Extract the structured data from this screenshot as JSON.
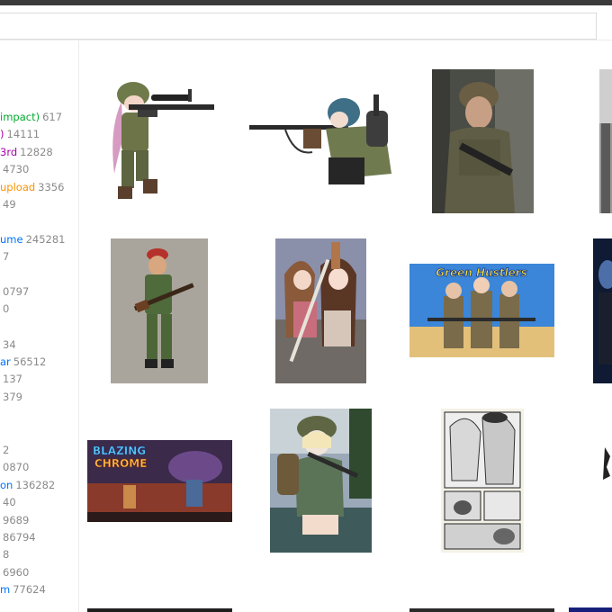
{
  "sidebar": {
    "tags": [
      {
        "name": "impact)",
        "count": "617",
        "color": "#00ab2c"
      },
      {
        "name": ")",
        "count": "14111",
        "color": "#a800aa"
      },
      {
        "name": "3rd",
        "count": "12828",
        "color": "#a800aa"
      },
      {
        "name": "",
        "count": "4730",
        "color": "#8a8a8a"
      },
      {
        "name": "upload",
        "count": "3356",
        "color": "#fd9200"
      },
      {
        "name": "",
        "count": "49",
        "color": "#8a8a8a"
      },
      {
        "name": "ume",
        "count": "245281",
        "color": "#0073ff"
      },
      {
        "name": "",
        "count": "7",
        "color": "#8a8a8a"
      },
      {
        "name": "",
        "count": "0797",
        "color": "#8a8a8a"
      },
      {
        "name": "",
        "count": "0",
        "color": "#8a8a8a"
      },
      {
        "name": "",
        "count": "34",
        "color": "#8a8a8a"
      },
      {
        "name": "ar",
        "count": "56512",
        "color": "#0073ff"
      },
      {
        "name": "",
        "count": "137",
        "color": "#8a8a8a"
      },
      {
        "name": "",
        "count": "379",
        "color": "#8a8a8a"
      },
      {
        "name": "",
        "count": "2",
        "color": "#8a8a8a"
      },
      {
        "name": "",
        "count": "0870",
        "color": "#8a8a8a"
      },
      {
        "name": "on",
        "count": "136282",
        "color": "#0073ff"
      },
      {
        "name": "",
        "count": "40",
        "color": "#8a8a8a"
      },
      {
        "name": "",
        "count": "9689",
        "color": "#8a8a8a"
      },
      {
        "name": "",
        "count": "86794",
        "color": "#8a8a8a"
      },
      {
        "name": "",
        "count": "8",
        "color": "#8a8a8a"
      },
      {
        "name": "",
        "count": "6960",
        "color": "#8a8a8a"
      },
      {
        "name": "m",
        "count": "77624",
        "color": "#0073ff"
      }
    ]
  },
  "posts": {
    "row1": [
      "thumb-1",
      "thumb-2",
      "thumb-3",
      "thumb-4"
    ],
    "blazing_title_line1": "BLAZING",
    "blazing_title_line2": "CHROME",
    "banner_text": "Green Hustlers"
  }
}
